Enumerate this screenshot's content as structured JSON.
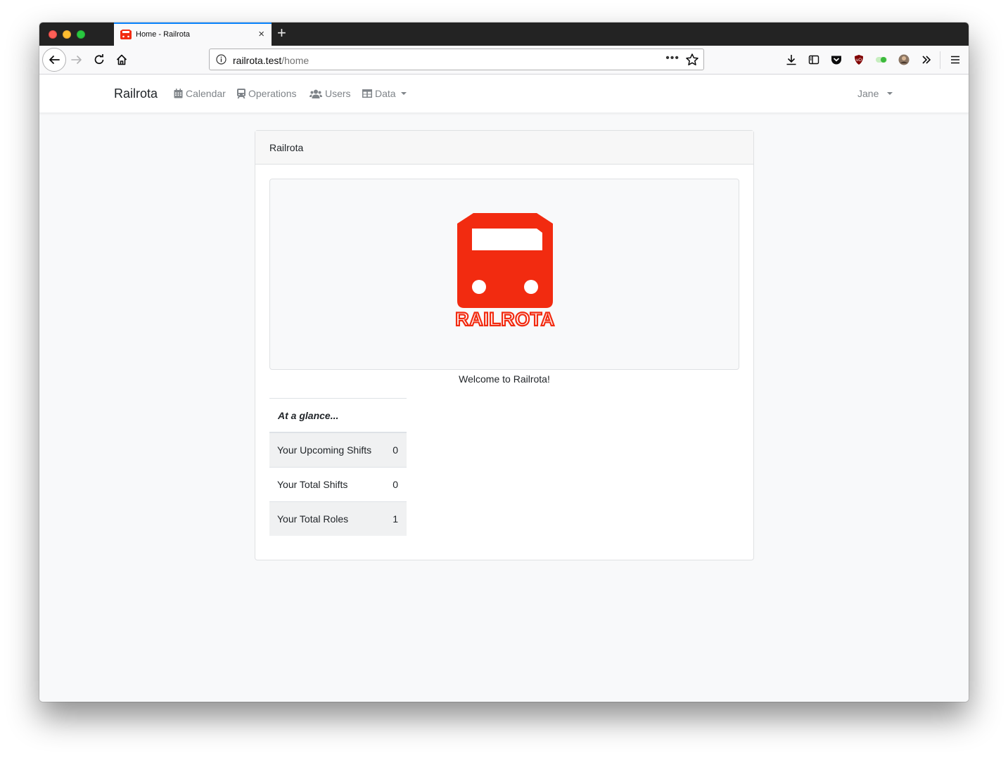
{
  "browser": {
    "tab_title": "Home - Railrota",
    "url_domain": "railrota.test",
    "url_path": "/home",
    "new_tab_glyph": "+",
    "tab_close_glyph": "×",
    "url_dots_glyph": "•••"
  },
  "navbar": {
    "brand": "Railrota",
    "items": [
      {
        "label": "Calendar",
        "icon": "calendar-icon"
      },
      {
        "label": "Operations",
        "icon": "train-icon"
      },
      {
        "label": "Users",
        "icon": "users-icon"
      },
      {
        "label": "Data",
        "icon": "table-icon"
      }
    ],
    "user": "Jane"
  },
  "card": {
    "header": "Railrota",
    "logo_text": "RAILROTA",
    "welcome": "Welcome to Railrota!",
    "glance": {
      "title": "At a glance...",
      "rows": [
        {
          "label": "Your Upcoming Shifts",
          "value": "0"
        },
        {
          "label": "Your Total Shifts",
          "value": "0"
        },
        {
          "label": "Your Total Roles",
          "value": "1"
        }
      ]
    }
  },
  "colors": {
    "brand_red": "#f22b10",
    "accent_blue": "#0a84ff"
  }
}
